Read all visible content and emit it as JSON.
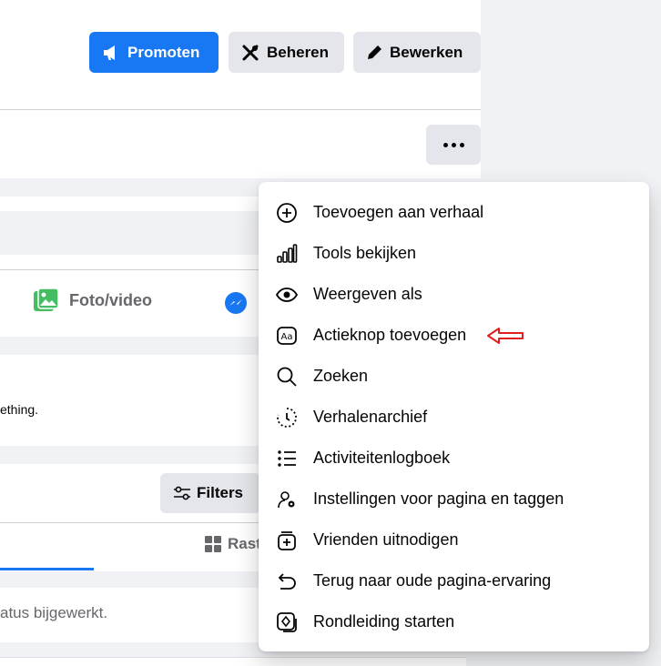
{
  "header": {
    "promote_label": "Promoten",
    "manage_label": "Beheren",
    "edit_label": "Bewerken"
  },
  "composer": {
    "photo_video_label": "Foto/video"
  },
  "post": {
    "snippet": "ething."
  },
  "posts": {
    "filters_label": "Filters",
    "grid_tab_label": "Rast"
  },
  "status": {
    "text": "atus bijgewerkt."
  },
  "menu": {
    "items": [
      {
        "label": "Toevoegen aan verhaal",
        "icon": "plus-circle-icon"
      },
      {
        "label": "Tools bekijken",
        "icon": "bar-chart-icon"
      },
      {
        "label": "Weergeven als",
        "icon": "eye-icon"
      },
      {
        "label": "Actieknop toevoegen",
        "icon": "text-button-icon"
      },
      {
        "label": "Zoeken",
        "icon": "search-icon"
      },
      {
        "label": "Verhalenarchief",
        "icon": "archive-clock-icon"
      },
      {
        "label": "Activiteitenlogboek",
        "icon": "list-icon"
      },
      {
        "label": "Instellingen voor pagina en taggen",
        "icon": "tag-settings-icon"
      },
      {
        "label": "Vrienden uitnodigen",
        "icon": "invite-icon"
      },
      {
        "label": "Terug naar oude pagina-ervaring",
        "icon": "undo-icon"
      },
      {
        "label": "Rondleiding starten",
        "icon": "tour-icon"
      }
    ]
  },
  "colors": {
    "primary": "#1877f2",
    "secondary_bg": "#e4e6eb",
    "annotation_arrow": "#e02020"
  }
}
